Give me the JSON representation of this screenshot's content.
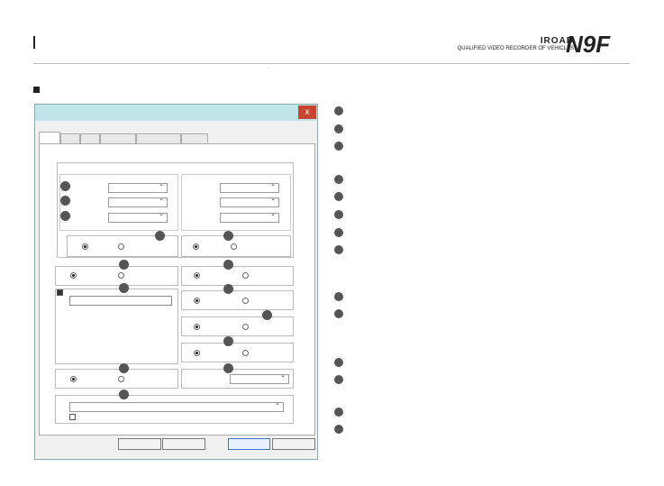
{
  "header": {
    "brand": "IROAD",
    "tagline": "QUALIFIED VIDEO RECORDER OF VEHICLES",
    "logo_text": "N9F"
  },
  "dialog": {
    "close_label": "x"
  }
}
